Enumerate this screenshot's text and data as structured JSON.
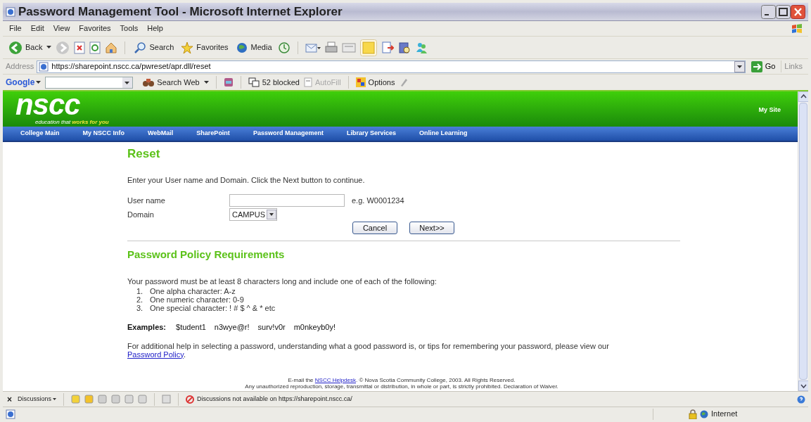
{
  "window": {
    "title": "Password Management Tool - Microsoft Internet Explorer"
  },
  "menu": [
    "File",
    "Edit",
    "View",
    "Favorites",
    "Tools",
    "Help"
  ],
  "toolbar": {
    "back": "Back",
    "search": "Search",
    "favorites": "Favorites",
    "media": "Media"
  },
  "address_bar": {
    "label": "Address",
    "url": "https://sharepoint.nscc.ca/pwreset/apr.dll/reset",
    "go": "Go",
    "links": "Links"
  },
  "google_bar": {
    "logo": "Google",
    "search_web": "Search Web",
    "blocked": "52 blocked",
    "autofill": {
      "label": "AutoFill",
      "disabled": true
    },
    "options": "Options"
  },
  "site_header": {
    "logo": "nscc",
    "tagline": "education that",
    "tagline_highlight": "works for you",
    "my_site": "My Site"
  },
  "nav": [
    "College Main",
    "My NSCC Info",
    "WebMail",
    "SharePoint",
    "Password Management",
    "Library Services",
    "Online Learning"
  ],
  "reset_form": {
    "heading": "Reset",
    "instructions": "Enter your User name and Domain. Click the Next button to continue.",
    "user_name": {
      "label": "User name",
      "hint": "e.g. W0001234"
    },
    "domain": {
      "label": "Domain",
      "value": "CAMPUS"
    },
    "buttons": [
      "Cancel",
      "Next>>"
    ]
  },
  "policy": {
    "heading": "Password Policy Requirements",
    "intro": "Your password must be at least 8 characters long and include one of each of the following:",
    "requirements": [
      {
        "number": "1.",
        "text": "One alpha character: A-z"
      },
      {
        "number": "2.",
        "text": "One numeric character: 0-9"
      },
      {
        "number": "3.",
        "text": "One special character: ! # $ ^ & * etc"
      }
    ],
    "examples_label": "Examples:",
    "examples": [
      "$tudent1",
      "n3wye@r!",
      "surv!v0r",
      "m0nkeyb0y!"
    ],
    "help_text": "For additional help in selecting a password, understanding what a good password is, or tips for remembering your password, please view our",
    "help_link": "Password Policy",
    "help_end": "."
  },
  "footer": {
    "line1_start": "E-mail the",
    "line1_link": "NSCC Helpdesk",
    "line1_end": ". © Nova Scotia Community College, 2003. All Rights Reserved.",
    "line2": "Any unauthorized reproduction, storage, transmittal or distribution, in whole or part, is strictly prohibited. Declaration of Waiver."
  },
  "discussions_bar": {
    "close": "×",
    "label": "Discussions",
    "message": "Discussions not available on https://sharepoint.nscc.ca/"
  },
  "status_bar": {
    "zone": "Internet"
  }
}
